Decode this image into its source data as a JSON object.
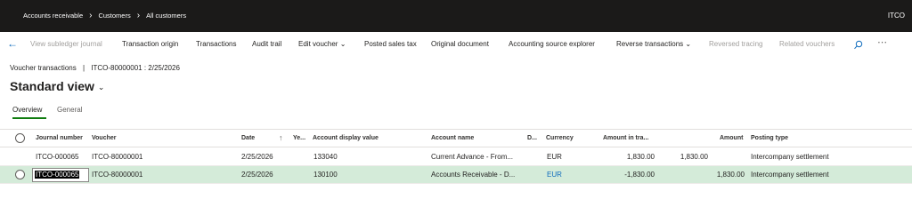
{
  "breadcrumb": [
    "Accounts receivable",
    "Customers",
    "All customers"
  ],
  "company": "ITCO",
  "actions": [
    {
      "label": "View subledger journal",
      "disabled": true
    },
    {
      "label": "Transaction origin",
      "disabled": false
    },
    {
      "label": "Transactions",
      "disabled": false
    },
    {
      "label": "Audit trail",
      "disabled": false
    },
    {
      "label": "Edit voucher",
      "disabled": false,
      "dropdown": true
    },
    {
      "label": "Posted sales tax",
      "disabled": false
    },
    {
      "label": "Original document",
      "disabled": false
    },
    {
      "label": "Accounting source explorer",
      "disabled": false
    },
    {
      "label": "Reverse transactions",
      "disabled": false,
      "dropdown": true
    },
    {
      "label": "Reversed tracing",
      "disabled": true
    },
    {
      "label": "Related vouchers",
      "disabled": true
    }
  ],
  "icons": {
    "back": "back-arrow-icon",
    "search": "search-icon",
    "more": "more-icon"
  },
  "page": {
    "voucher_title": "Voucher transactions",
    "voucher_separator": "|",
    "voucher_id": "ITCO-80000001 : 2/25/2026",
    "view_name": "Standard view"
  },
  "tabs": [
    "Overview",
    "General"
  ],
  "columns": {
    "journal_number": "Journal number",
    "voucher": "Voucher",
    "date": "Date",
    "year": "Ye...",
    "account_display_value": "Account display value",
    "account_name": "Account name",
    "d": "D...",
    "currency": "Currency",
    "amount_in_transaction": "Amount in tra...",
    "amount": "Amount",
    "posting_type": "Posting type"
  },
  "rows": [
    {
      "journal_number": "ITCO-000065",
      "voucher": "ITCO-80000001",
      "date": "2/25/2026",
      "account_display_value": "133040",
      "account_name": "Current Advance - From...",
      "currency": "EUR",
      "amount_in_transaction": "1,830.00",
      "amount_debit": "1,830.00",
      "amount": "",
      "posting_type": "Intercompany settlement"
    },
    {
      "journal_number": "ITCO-000065",
      "voucher": "ITCO-80000001",
      "date": "2/25/2026",
      "account_display_value": "130100",
      "account_name": "Accounts Receivable - D...",
      "currency": "EUR",
      "amount_in_transaction": "-1,830.00",
      "amount_debit": "",
      "amount": "1,830.00",
      "posting_type": "Intercompany settlement"
    }
  ],
  "colors": {
    "topbar": "#1b1a19",
    "selected_row": "#d4ebd9",
    "accent": "#107c10",
    "link": "#0f6cbd"
  }
}
